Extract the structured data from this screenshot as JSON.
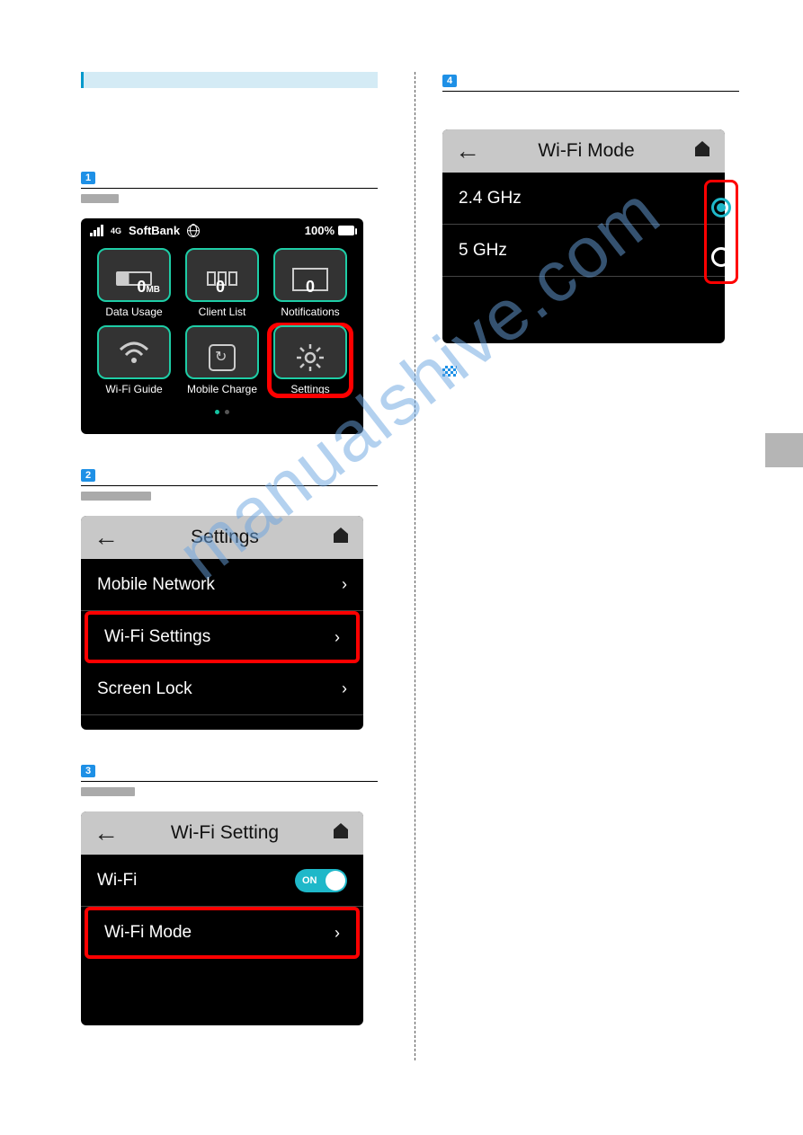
{
  "watermark": "manualshive.com",
  "home": {
    "carrier": "SoftBank",
    "network_type": "4G",
    "battery": "100%",
    "tiles": [
      {
        "label": "Data Usage",
        "value": "0",
        "unit": "MB"
      },
      {
        "label": "Client List",
        "value": "0",
        "unit": ""
      },
      {
        "label": "Notifications",
        "value": "0",
        "unit": ""
      },
      {
        "label": "Wi-Fi Guide",
        "value": "",
        "unit": ""
      },
      {
        "label": "Mobile Charge",
        "value": "",
        "unit": ""
      },
      {
        "label": "Settings",
        "value": "",
        "unit": ""
      }
    ]
  },
  "settings": {
    "title": "Settings",
    "rows": [
      "Mobile Network",
      "Wi-Fi Settings",
      "Screen Lock"
    ]
  },
  "wifi_setting": {
    "title": "Wi-Fi Setting",
    "wifi_label": "Wi-Fi",
    "toggle": "ON",
    "mode_label": "Wi-Fi Mode"
  },
  "wifi_mode": {
    "title": "Wi-Fi Mode",
    "options": [
      "2.4 GHz",
      "5 GHz"
    ]
  },
  "steps": [
    "1",
    "2",
    "3",
    "4"
  ]
}
